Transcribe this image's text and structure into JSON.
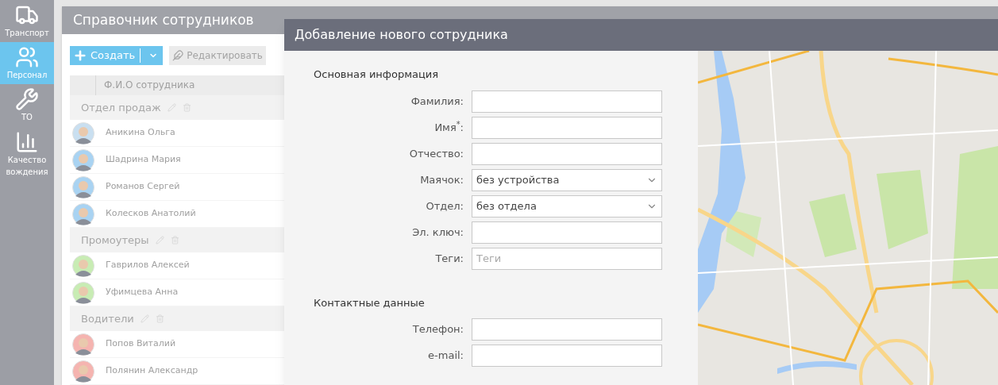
{
  "sidebar": {
    "items": [
      {
        "label": "Транспорт",
        "selected": false
      },
      {
        "label": "Персонал",
        "selected": true
      },
      {
        "label": "ТО",
        "selected": false
      },
      {
        "label": "Качество вождения",
        "selected": false
      }
    ]
  },
  "directory": {
    "title": "Справочник сотрудников",
    "toolbar": [
      {
        "kind": "create",
        "label": "Создать",
        "disabled": false
      },
      {
        "kind": "edit",
        "label": "Редактировать",
        "disabled": true
      }
    ],
    "columns": [
      "Ф.И.О сотрудника"
    ],
    "groups": [
      {
        "name": "Отдел продаж",
        "employees": [
          {
            "name": "Аникина Ольга",
            "color": "#c9dff0"
          },
          {
            "name": "Шадрина Мария",
            "color": "#a9d3f2"
          },
          {
            "name": "Романов Сергей",
            "color": "#a9d3f2"
          },
          {
            "name": "Колесков Анатолий",
            "color": "#a9d3f2"
          }
        ]
      },
      {
        "name": "Промоутеры",
        "employees": [
          {
            "name": "Гаврилов Алексей",
            "color": "#c8ecb4"
          },
          {
            "name": "Уфимцева Анна",
            "color": "#c8ecb4"
          }
        ]
      },
      {
        "name": "Водители",
        "employees": [
          {
            "name": "Попов Виталий",
            "color": "#f5b4b0"
          },
          {
            "name": "Полянин Александр",
            "color": "#f5b4b0"
          }
        ]
      }
    ]
  },
  "dialog": {
    "title": "Добавление нового сотрудника",
    "sections": [
      {
        "title": "Основная информация",
        "fields": [
          {
            "label": "Фамилия:",
            "kind": "text"
          },
          {
            "label": "Имя$^{*}$:",
            "kind": "text"
          },
          {
            "label": "Отчество:",
            "kind": "text"
          },
          {
            "label": "Маячок:",
            "kind": "select",
            "value": "без устройства"
          },
          {
            "label": "Отдел:",
            "kind": "select",
            "value": "без отдела"
          },
          {
            "label": "Эл. ключ:",
            "kind": "text"
          },
          {
            "label": "Теги:",
            "kind": "text",
            "placeholder": "Теги"
          }
        ]
      },
      {
        "title": "Контактные данные",
        "fields": [
          {
            "label": "Телефон:",
            "kind": "text"
          },
          {
            "label": "e-mail:",
            "kind": "text"
          }
        ]
      }
    ]
  }
}
